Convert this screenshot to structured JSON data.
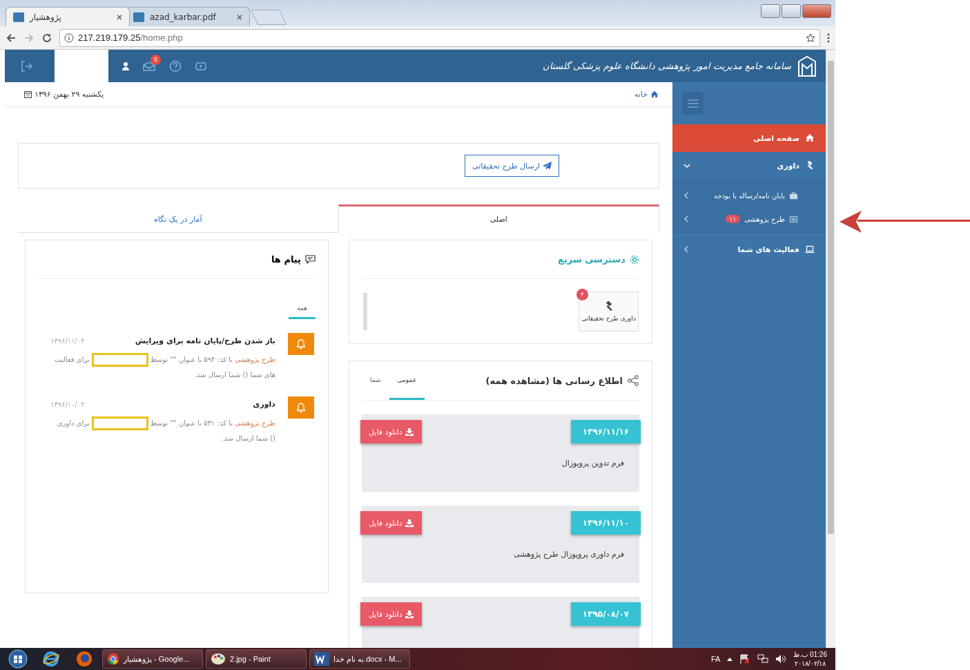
{
  "browser": {
    "tabs": [
      {
        "title": "azad_karbar.pdf",
        "selected": false
      },
      {
        "title": "پژوهشیار",
        "selected": true
      }
    ],
    "address": {
      "host": "217.219.179.25",
      "path": "/home.php"
    }
  },
  "header": {
    "title": "سامانه جامع مدیریت امور پژوهشی دانشگاه علوم پزشکی گلستان",
    "mail_badge": "5"
  },
  "sidebar": {
    "items": [
      {
        "label": "صفحه اصلی",
        "selected": true
      },
      {
        "label": "داوری",
        "selected": false,
        "expanded": true,
        "children": [
          {
            "label": "پایان نامه/رساله با بودجه",
            "selected": false
          },
          {
            "label": "طرح پژوهشی",
            "selected": false,
            "badge": "۱۱"
          }
        ]
      },
      {
        "label": "فعالیت های شما",
        "selected": false,
        "expanded": false
      }
    ]
  },
  "breadcrumb": {
    "label": "خانه"
  },
  "date": "یکشنبه ۲۹ بهمن ۱۳۹۶",
  "actions": {
    "button": "ارسال طرح تحقیقاتی"
  },
  "main_tabs": [
    {
      "label": "اصلی",
      "selected": true
    },
    {
      "label": "آمار در یک نگاه",
      "selected": false
    }
  ],
  "quick_access": {
    "title": "دسترسی سریع",
    "items": [
      {
        "label": "داوری طرح تحقیقاتی",
        "badge": "۲"
      }
    ]
  },
  "announcements": {
    "title": "اطلاع رسانی ها (مشاهده همه)",
    "tabs": [
      {
        "label": "عمومی",
        "selected": true
      },
      {
        "label": "شما",
        "selected": false
      }
    ],
    "items": [
      {
        "date": "۱۳۹۶/۱۱/۱۶",
        "text": "فرم تدوین پروپوزال",
        "button": "دانلود فایل"
      },
      {
        "date": "۱۳۹۶/۱۱/۱۰",
        "text": "فرم داوری پروپوزال طرح پژوهشی",
        "button": "دانلود فایل"
      },
      {
        "date": "۱۳۹۵/۰۸/۰۷",
        "button": "دانلود فایل"
      }
    ]
  },
  "messages": {
    "title": "پیام ها",
    "tabs": [
      {
        "label": "همه",
        "selected": true
      }
    ],
    "items": [
      {
        "title": "باز شدن طرح/پایان نامه برای ویرایش",
        "date": "۱۳۹۶/۱۱/۰۴",
        "link": "طرح پژوهشی",
        "text": "با کد: ۵۹۴ با عنوان \"\" توسط",
        "after": "برای فعالیت های شما () شما ارسال شد."
      },
      {
        "title": "داوری",
        "date": "۱۳۹۶/۱۰/۰۲",
        "link": "طرح پژوهشی",
        "text": "با کد: ۵۳۱ با عنوان \"\" توسط",
        "after": "برای داوری () شما ارسال شد."
      }
    ]
  },
  "taskbar": {
    "tasks": [
      {
        "label": "به نام خدا.docx - M..."
      },
      {
        "label": "2.jpg - Paint"
      },
      {
        "label": "پژوهشیار - Google..."
      }
    ],
    "language": "FA",
    "time": "01:26 ب.ظ",
    "date": "۲۰۱۸/۰۲/۱۸"
  }
}
